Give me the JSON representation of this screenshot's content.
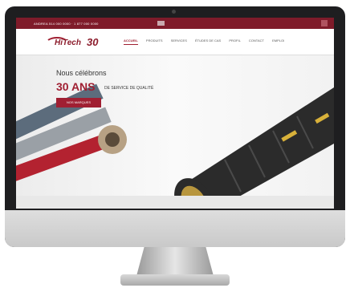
{
  "topbar": {
    "contact": "ANDREA 514 000 0000 · 1 877 000 0000",
    "flag_label": "EN"
  },
  "logo": {
    "brand": "HiTech",
    "number": "30"
  },
  "menu": [
    "ACCUEIL",
    "PRODUITS",
    "SERVICES",
    "ÉTUDES DE CAS",
    "PROFIL",
    "CONTACT",
    "EMPLOI"
  ],
  "hero": {
    "kicker": "Nous célébrons",
    "big": "30 ANS",
    "sub": "DE SERVICE DE QUALITÉ",
    "cta": "NOS MARQUES"
  },
  "colors": {
    "brand": "#a01f32",
    "topbar": "#7f1b2a"
  }
}
